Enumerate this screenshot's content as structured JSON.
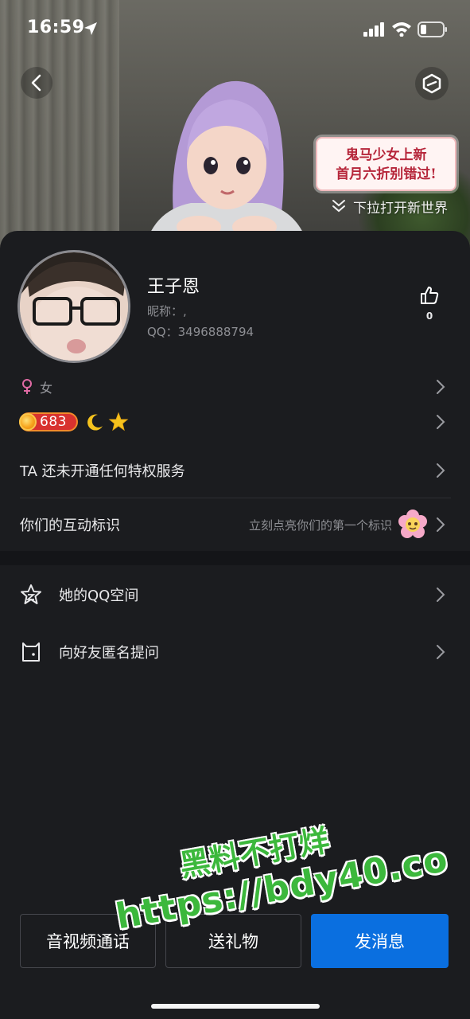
{
  "status_bar": {
    "time": "16:59"
  },
  "hero": {
    "promo_line1": "鬼马少女上新",
    "promo_line2": "首月六折别错过!",
    "pull_hint": "下拉打开新世界"
  },
  "profile": {
    "name": "王子恩",
    "nickname": "昵称：,",
    "qq": "QQ：3496888794",
    "like_count": "0",
    "gender": "女",
    "level": "683"
  },
  "rows": {
    "privilege": "TA 还未开通任何特权服务",
    "interaction": "你们的互动标识",
    "interaction_hint": "立刻点亮你们的第一个标识",
    "qzone": "她的QQ空间",
    "ask": "向好友匿名提问"
  },
  "actions": {
    "av_call": "音视频通话",
    "gift": "送礼物",
    "message": "发消息"
  },
  "watermark": {
    "line1": "黑料不打烊",
    "line2": "https://bdy40.co"
  },
  "colors": {
    "background": "#1b1c1f",
    "primary_button": "#0a6fe0",
    "level_badge": "#d8322f",
    "watermark": "#3cb83c"
  }
}
